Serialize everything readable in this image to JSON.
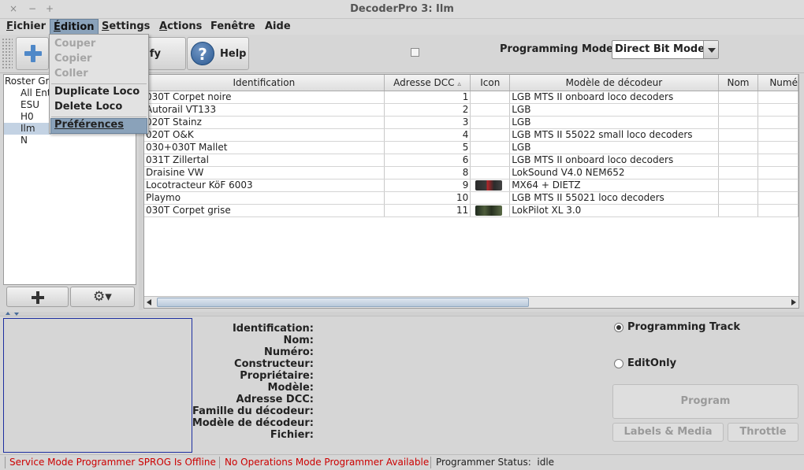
{
  "window": {
    "title": "DecoderPro 3: Ilm",
    "close": "×",
    "minimize": "−",
    "maximize": "+"
  },
  "menubar": {
    "fichier": {
      "first": "F",
      "rest": "ichier"
    },
    "edition": {
      "first": "É",
      "rest": "dition"
    },
    "settings": {
      "first": "S",
      "rest": "ettings"
    },
    "actions": {
      "first": "A",
      "rest": "ctions"
    },
    "fenetre": "Fenêtre",
    "aide": "Aide"
  },
  "edition_menu": {
    "couper": "Couper",
    "copier": "Copier",
    "coller": "Coller",
    "duplicate": "Duplicate Loco",
    "delete": "Delete Loco",
    "preferences": "Préférences"
  },
  "toolbar": {
    "identify_label": "Identify",
    "help_label": "Help",
    "help_glyph": "?",
    "programming_mode_label": "Programming Mode",
    "programming_mode_value": "Direct Bit Mode"
  },
  "roster_groups": {
    "header": "Roster Gr",
    "items": [
      "All Ent",
      "ESU",
      "H0",
      "Ilm",
      "N"
    ],
    "selected": "Ilm"
  },
  "table": {
    "columns": [
      "Identification",
      "Adresse DCC",
      "Icon",
      "Modèle de décodeur",
      "Nom",
      "Numé"
    ],
    "sort_indicator": "▵",
    "rows": [
      {
        "id": "030T Corpet noire",
        "dcc": "1",
        "icon": "",
        "model": "LGB MTS II onboard loco decoders"
      },
      {
        "id": "Autorail VT133",
        "dcc": "2",
        "icon": "",
        "model": "LGB"
      },
      {
        "id": "020T Stainz",
        "dcc": "3",
        "icon": "",
        "model": "LGB"
      },
      {
        "id": "020T O&K",
        "dcc": "4",
        "icon": "",
        "model": "LGB MTS II 55022 small loco decoders"
      },
      {
        "id": "030+030T Mallet",
        "dcc": "5",
        "icon": "",
        "model": "LGB"
      },
      {
        "id": "031T Zillertal",
        "dcc": "6",
        "icon": "",
        "model": "LGB MTS II onboard loco decoders"
      },
      {
        "id": "Draisine VW",
        "dcc": "8",
        "icon": "",
        "model": "LokSound V4.0 NEM652"
      },
      {
        "id": "Locotracteur KöF 6003",
        "dcc": "9",
        "icon": "loco-photo-red",
        "model": "MX64 + DIETZ"
      },
      {
        "id": "Playmo",
        "dcc": "10",
        "icon": "",
        "model": "LGB MTS II 55021 loco decoders"
      },
      {
        "id": "030T Corpet grise",
        "dcc": "11",
        "icon": "loco-photo-green",
        "model": "LokPilot XL 3.0"
      }
    ]
  },
  "details": {
    "labels": [
      "Identification:",
      "Nom:",
      "Numéro:",
      "Constructeur:",
      "Propriétaire:",
      "Modèle:",
      "Adresse DCC:",
      "Famille du décodeur:",
      "Modèle de décodeur:",
      "Fichier:"
    ]
  },
  "programming": {
    "track_label": "Programming Track",
    "track_selected": true,
    "editonly_label": "EditOnly",
    "program_button": "Program",
    "labels_media_button": "Labels & Media",
    "throttle_button": "Throttle"
  },
  "status": {
    "service": "Service Mode Programmer SPROG Is Offline",
    "operations": "No Operations Mode Programmer Available",
    "programmer_status": "Programmer Status:  idle"
  },
  "colors": {
    "error_text": "#cc0000",
    "selection": "#8aa2ba",
    "image_border": "#1d2fa0"
  },
  "icons": [
    "plus-icon",
    "help-icon",
    "gear-icon",
    "chevron-down-icon",
    "mouse-cursor-icon"
  ]
}
